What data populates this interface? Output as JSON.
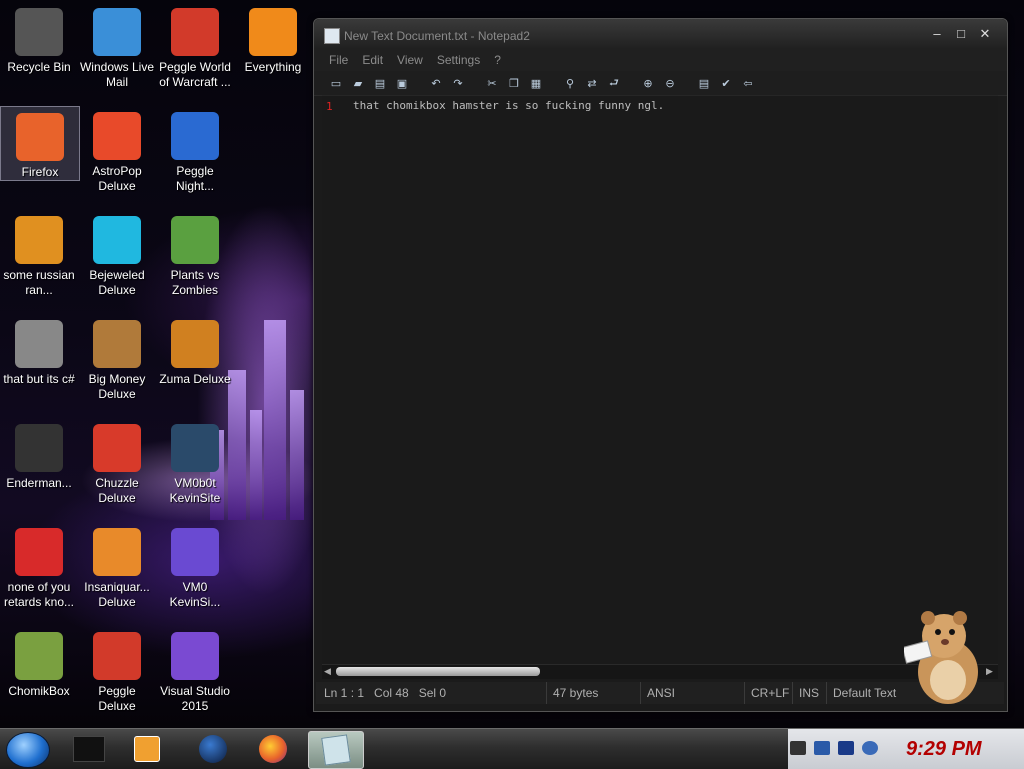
{
  "desktop": {
    "icons": [
      {
        "label": "Recycle Bin",
        "icon": "recycle-bin-icon",
        "color": "#555555"
      },
      {
        "label": "Windows Live Mail",
        "icon": "mail-icon",
        "color": "#3a8fd8"
      },
      {
        "label": "Peggle World of Warcraft ...",
        "icon": "peggle-icon",
        "color": "#d23a2a"
      },
      {
        "label": "Everything",
        "icon": "magnifier-icon",
        "color": "#f08a1a"
      },
      {
        "label": "Firefox",
        "icon": "firefox-icon",
        "color": "#e8632b"
      },
      {
        "label": "AstroPop Deluxe",
        "icon": "astropop-icon",
        "color": "#e84a2a"
      },
      {
        "label": "Peggle Night...",
        "icon": "peggle-night-icon",
        "color": "#2a6ad2"
      },
      {
        "label": "some russian ran...",
        "icon": "de-icon",
        "color": "#e09020"
      },
      {
        "label": "Bejeweled Deluxe",
        "icon": "gem-icon",
        "color": "#20b8e0"
      },
      {
        "label": "Plants vs Zombies",
        "icon": "flower-icon",
        "color": "#5aa040"
      },
      {
        "label": "that but its c#",
        "icon": "windows-stack-icon",
        "color": "#888888"
      },
      {
        "label": "Big Money Deluxe",
        "icon": "money-bag-icon",
        "color": "#b07a3a"
      },
      {
        "label": "Zuma Deluxe",
        "icon": "zuma-icon",
        "color": "#d08020"
      },
      {
        "label": "Enderman...",
        "icon": "list-icon",
        "color": "#333333"
      },
      {
        "label": "Chuzzle Deluxe",
        "icon": "chuzzle-icon",
        "color": "#d83a2a"
      },
      {
        "label": "VM0b0t KevinSite",
        "icon": "screenshot-icon",
        "color": "#2a4a6a"
      },
      {
        "label": "none of you retards kno...",
        "icon": "dragon-icon",
        "color": "#d82a2a"
      },
      {
        "label": "Insaniquar... Deluxe",
        "icon": "fish-icon",
        "color": "#e88a2a"
      },
      {
        "label": "VM0 KevinSi...",
        "icon": "firefox-file-icon",
        "color": "#6a4ad2"
      },
      {
        "label": "ChomikBox",
        "icon": "hamster-box-icon",
        "color": "#7aa040"
      },
      {
        "label": "Peggle Deluxe",
        "icon": "peggle-deluxe-icon",
        "color": "#d23a2a"
      },
      {
        "label": "Visual Studio 2015",
        "icon": "visual-studio-icon",
        "color": "#7a4ad2"
      }
    ]
  },
  "notepad": {
    "title": "New Text Document.txt - Notepad2",
    "menu": [
      "File",
      "Edit",
      "View",
      "Settings",
      "?"
    ],
    "toolbar": [
      "new-icon",
      "open-icon",
      "browse-icon",
      "save-icon",
      "undo-icon",
      "redo-icon",
      "cut-icon",
      "copy-icon",
      "paste-icon",
      "find-icon",
      "replace-icon",
      "word-wrap-icon",
      "zoom-in-icon",
      "zoom-out-icon",
      "scheme-icon",
      "customize-icon",
      "exit-icon"
    ],
    "line_number": "1",
    "text": "that chomikbox hamster is so fucking funny ngl.",
    "status": {
      "position": "Ln 1 : 1   Col 48   Sel 0",
      "size": "47 bytes",
      "encoding": "ANSI",
      "eol": "CR+LF",
      "mode": "INS",
      "scheme": "Default Text"
    }
  },
  "taskbar": {
    "clock": "9:29 PM",
    "tasks": [
      {
        "icon": "black-box-icon",
        "color": "#111111"
      },
      {
        "icon": "media-player-icon",
        "color": "#f0a030"
      },
      {
        "icon": "globe-icon",
        "color": "#1a4a8a"
      },
      {
        "icon": "firefox-icon",
        "color": "#e8632b"
      },
      {
        "icon": "notepad-icon",
        "color": "#cfe3ea"
      }
    ]
  }
}
